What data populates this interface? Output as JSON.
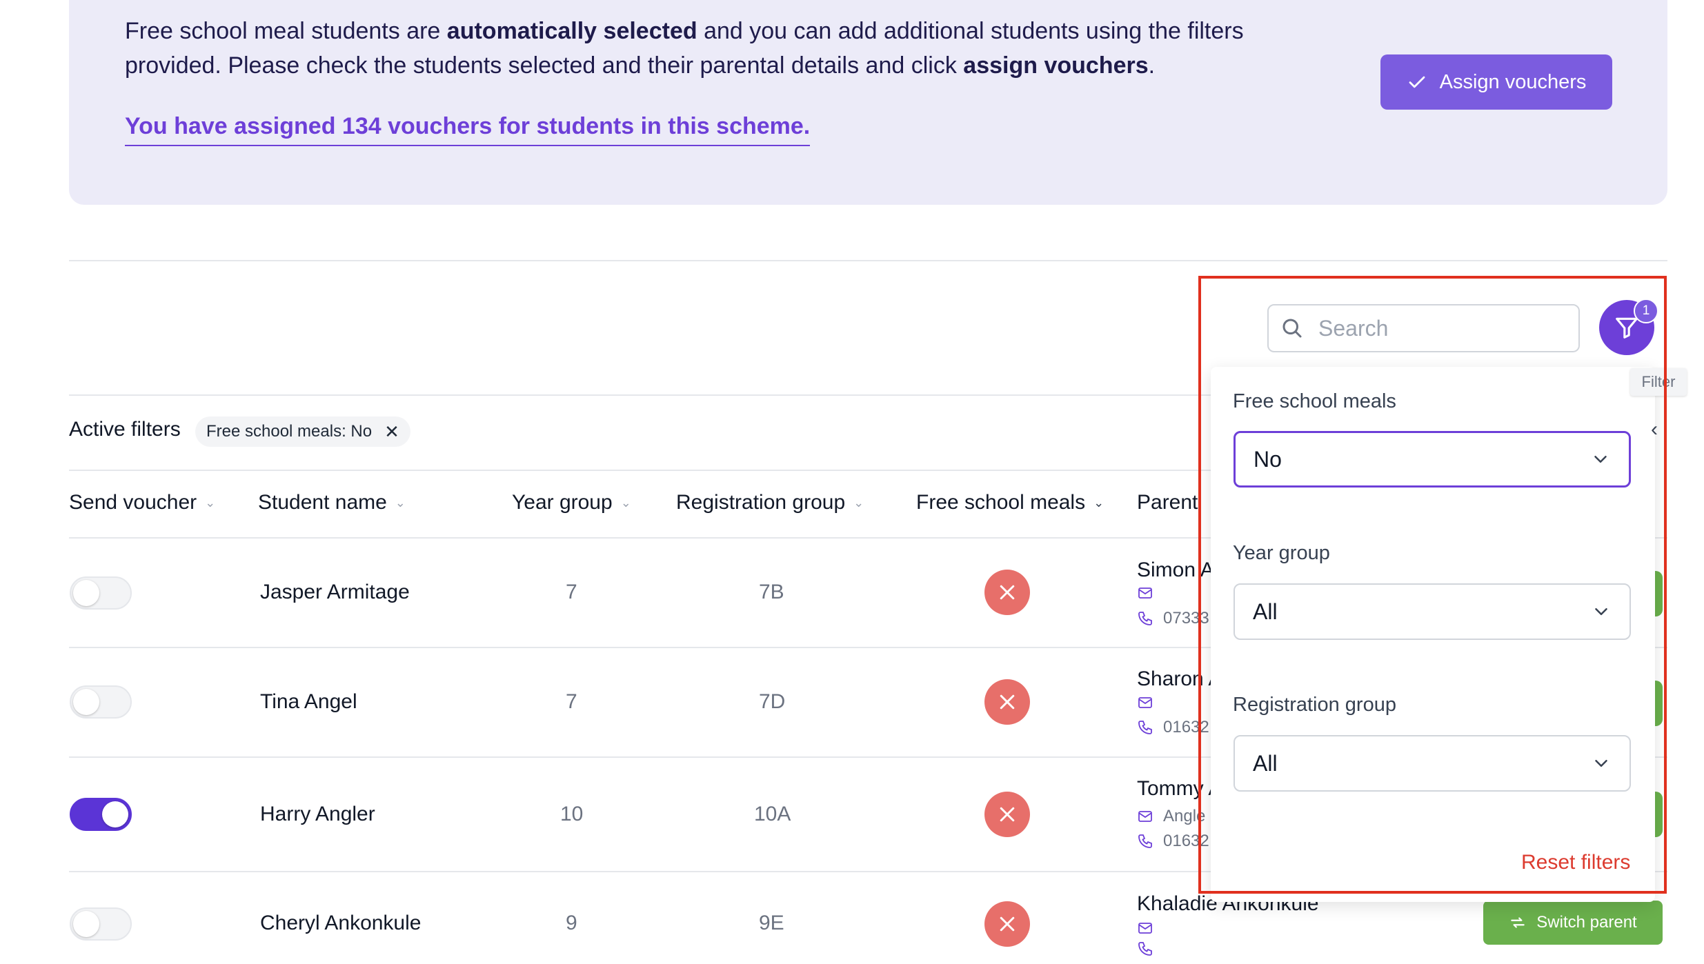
{
  "banner": {
    "text_part1": "Free school meal students are ",
    "text_bold1": "automatically selected",
    "text_part2": " and you can add additional students using the filters provided. Please check the students selected and their parental details and click ",
    "text_bold2": "assign vouchers",
    "text_part3": ".",
    "assigned_link": "You have assigned 134 vouchers for students in this scheme.",
    "assign_button": "Assign vouchers"
  },
  "active_filters": {
    "label": "Active filters",
    "chip": "Free school meals: No"
  },
  "table": {
    "columns": [
      "Send voucher",
      "Student name",
      "Year group",
      "Registration group",
      "Free school meals",
      "Parent"
    ],
    "rows": [
      {
        "send": false,
        "name": "Jasper Armitage",
        "year": "7",
        "reg": "7B",
        "fsm": false,
        "parent_name": "Simon A",
        "email": "",
        "phone": "07333"
      },
      {
        "send": false,
        "name": "Tina Angel",
        "year": "7",
        "reg": "7D",
        "fsm": false,
        "parent_name": "Sharon A",
        "email": "",
        "phone": "01632"
      },
      {
        "send": true,
        "name": "Harry Angler",
        "year": "10",
        "reg": "10A",
        "fsm": false,
        "parent_name": "Tommy A",
        "email": "Angle",
        "phone": "01632"
      },
      {
        "send": false,
        "name": "Cheryl Ankonkule",
        "year": "9",
        "reg": "9E",
        "fsm": false,
        "parent_name": "Khaladie Ankonkule",
        "email": "",
        "phone": ""
      }
    ],
    "switch_parent": "Switch parent"
  },
  "search": {
    "placeholder": "Search"
  },
  "filter": {
    "badge": "1",
    "tooltip": "Filter",
    "fields": [
      {
        "label": "Free school meals",
        "value": "No"
      },
      {
        "label": "Year group",
        "value": "All"
      },
      {
        "label": "Registration group",
        "value": "All"
      }
    ],
    "reset": "Reset filters"
  },
  "colors": {
    "accent": "#6d3fd8",
    "banner_bg": "#ecebf8",
    "danger": "#e76f6a",
    "success": "#6ab04c",
    "highlight_box": "#e0301e"
  }
}
